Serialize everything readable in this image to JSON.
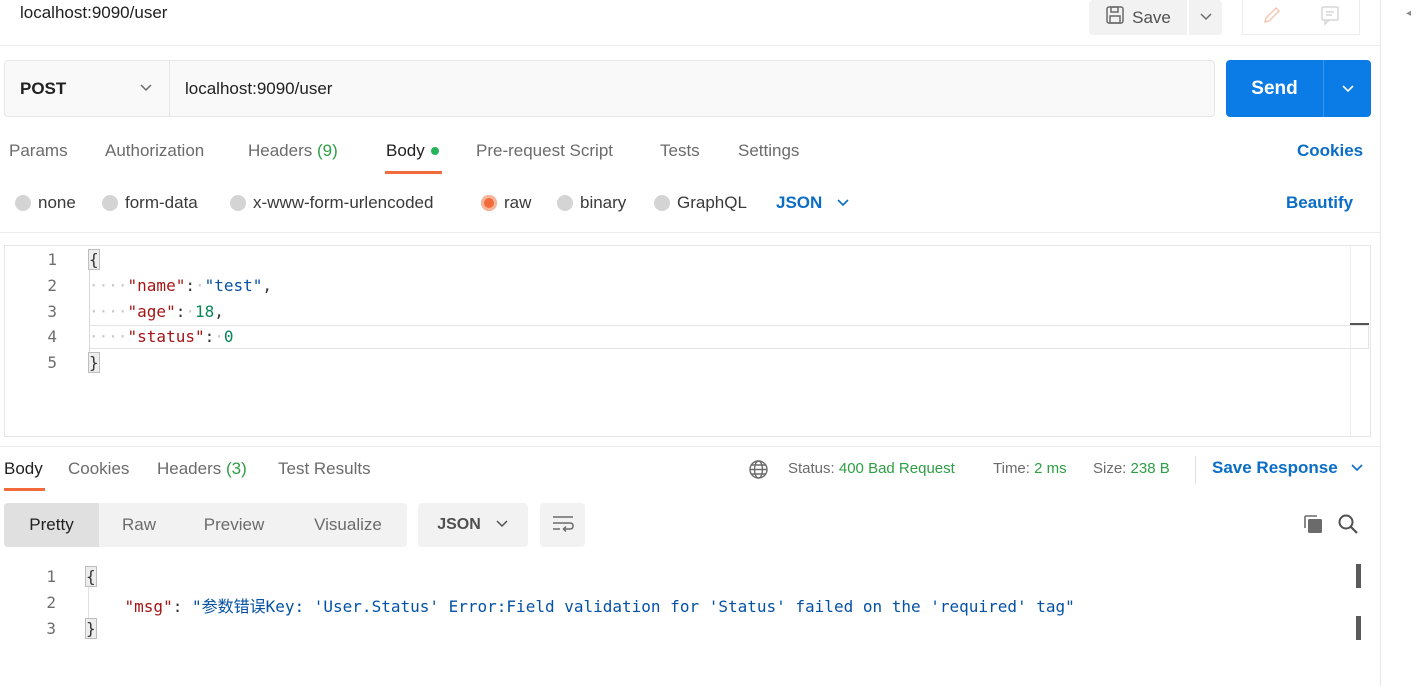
{
  "topbar": {
    "tab_title": "localhost:9090/user",
    "save_label": "Save",
    "icons": [
      "save-icon",
      "chevron-down-icon",
      "pencil-icon",
      "comment-icon"
    ]
  },
  "request": {
    "method": "POST",
    "url": "localhost:9090/user",
    "send_label": "Send",
    "tabs": {
      "params": "Params",
      "authorization": "Authorization",
      "headers": "Headers",
      "headers_count": "(9)",
      "body": "Body",
      "pre_request": "Pre-request Script",
      "tests": "Tests",
      "settings": "Settings"
    },
    "cookies_label": "Cookies",
    "body_types": {
      "none": "none",
      "form_data": "form-data",
      "urlencoded": "x-www-form-urlencoded",
      "raw": "raw",
      "binary": "binary",
      "graphql": "GraphQL"
    },
    "selected_body_type": "raw",
    "language": "JSON",
    "beautify_label": "Beautify",
    "editor": {
      "line_numbers": [
        "1",
        "2",
        "3",
        "4",
        "5"
      ],
      "open_brace": "{",
      "close_brace": "}",
      "fields": [
        {
          "key": "\"name\"",
          "value": "\"test\"",
          "suffix": ","
        },
        {
          "key": "\"age\"",
          "value": "18",
          "suffix": ","
        },
        {
          "key": "\"status\"",
          "value": "0",
          "suffix": ""
        }
      ]
    }
  },
  "response": {
    "tabs": {
      "body": "Body",
      "cookies": "Cookies",
      "headers": "Headers",
      "headers_count": "(3)",
      "test_results": "Test Results"
    },
    "status_label": "Status:",
    "status_value": "400 Bad Request",
    "time_label": "Time:",
    "time_value": "2 ms",
    "size_label": "Size:",
    "size_value": "238 B",
    "save_response_label": "Save Response",
    "views": {
      "pretty": "Pretty",
      "raw": "Raw",
      "preview": "Preview",
      "visualize": "Visualize"
    },
    "active_view": "Pretty",
    "format": "JSON",
    "editor": {
      "line_numbers": [
        "1",
        "2",
        "3"
      ],
      "open_brace": "{",
      "close_brace": "}",
      "key": "\"msg\"",
      "value": "\"参数错误Key: 'User.Status' Error:Field validation for 'Status' failed on the 'required' tag\""
    }
  },
  "colors": {
    "accent": "#f26b3a",
    "primary": "#0b7ce5",
    "link": "#0b6dc5",
    "success": "#2f9e44"
  }
}
